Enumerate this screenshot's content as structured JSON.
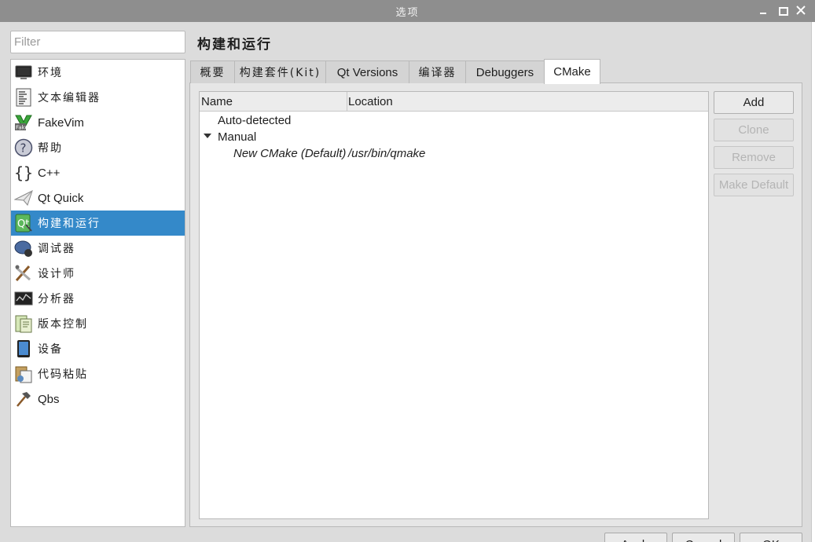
{
  "window": {
    "title": "选项"
  },
  "filter": {
    "placeholder": "Filter"
  },
  "sidebar": {
    "items": [
      {
        "label": "环境",
        "icon": "monitor-icon"
      },
      {
        "label": "文本编辑器",
        "icon": "text-editor-icon"
      },
      {
        "label": "FakeVim",
        "icon": "fakevim-icon"
      },
      {
        "label": "帮助",
        "icon": "help-icon"
      },
      {
        "label": "C++",
        "icon": "braces-icon"
      },
      {
        "label": "Qt Quick",
        "icon": "paper-plane-icon"
      },
      {
        "label": "构建和运行",
        "icon": "build-run-icon"
      },
      {
        "label": "调试器",
        "icon": "debugger-icon"
      },
      {
        "label": "设计师",
        "icon": "designer-icon"
      },
      {
        "label": "分析器",
        "icon": "analyzer-icon"
      },
      {
        "label": "版本控制",
        "icon": "version-control-icon"
      },
      {
        "label": "设备",
        "icon": "device-icon"
      },
      {
        "label": "代码粘贴",
        "icon": "code-paste-icon"
      },
      {
        "label": "Qbs",
        "icon": "hammer-icon"
      }
    ],
    "selected_index": 6
  },
  "page": {
    "title": "构建和运行"
  },
  "tabs": [
    {
      "label": "概要"
    },
    {
      "label": "构建套件(Kit)"
    },
    {
      "label": "Qt Versions"
    },
    {
      "label": "编译器"
    },
    {
      "label": "Debuggers"
    },
    {
      "label": "CMake"
    }
  ],
  "active_tab": "CMake",
  "cmake_table": {
    "columns": [
      "Name",
      "Location"
    ],
    "groups": [
      {
        "label": "Auto-detected",
        "expanded": false,
        "items": []
      },
      {
        "label": "Manual",
        "expanded": true,
        "items": [
          {
            "name": "New CMake (Default)",
            "location": "/usr/bin/qmake"
          }
        ]
      }
    ]
  },
  "buttons": {
    "add": "Add",
    "clone": "Clone",
    "remove": "Remove",
    "make_default": "Make Default"
  },
  "dialog_buttons": {
    "apply": "Apply",
    "cancel": "Cancel",
    "ok": "OK"
  },
  "colors": {
    "selection": "#3489c9",
    "titlebar": "#8e8e8e"
  }
}
